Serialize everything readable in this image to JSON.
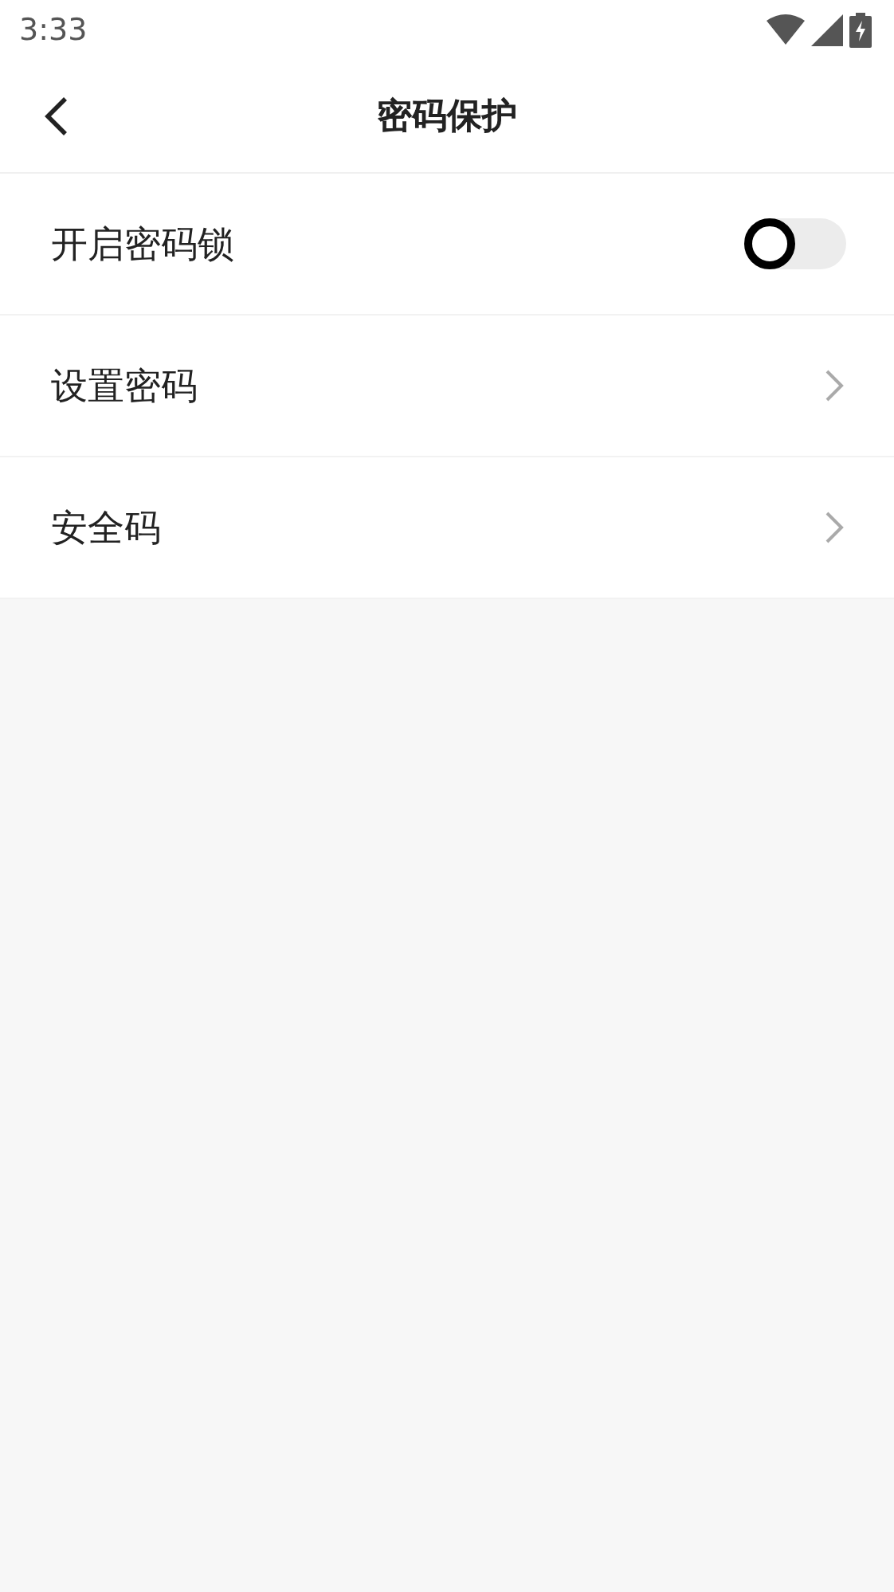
{
  "status_bar": {
    "time": "3:33"
  },
  "header": {
    "title": "密码保护"
  },
  "rows": [
    {
      "kind": "toggle",
      "label": "开启密码锁",
      "on": false
    },
    {
      "kind": "link",
      "label": "设置密码"
    },
    {
      "kind": "link",
      "label": "安全码"
    }
  ]
}
